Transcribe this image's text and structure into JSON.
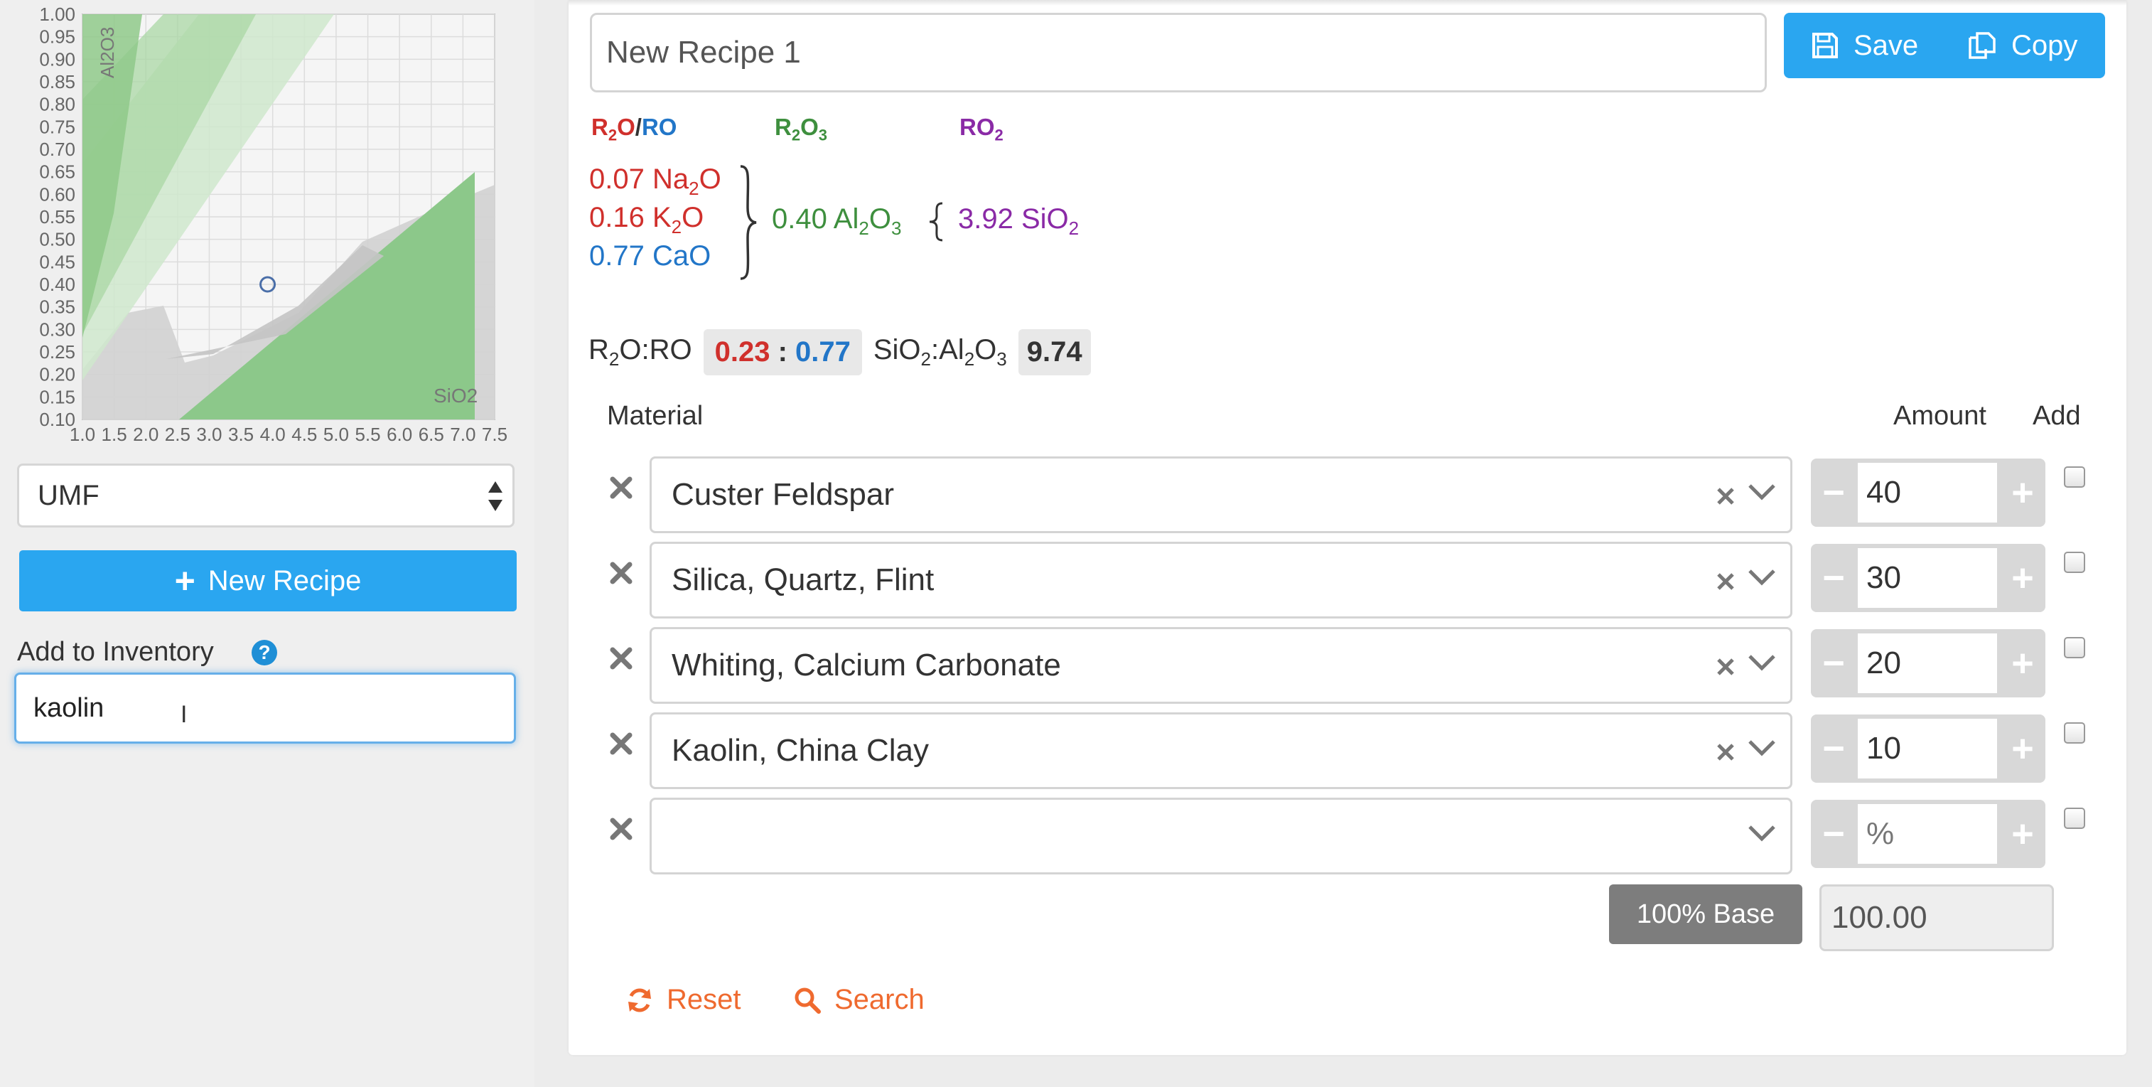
{
  "chart": {
    "y_axis_label": "Al2O3",
    "x_axis_label": "SiO2",
    "y_ticks": [
      "1.00",
      "0.95",
      "0.90",
      "0.85",
      "0.80",
      "0.75",
      "0.70",
      "0.65",
      "0.60",
      "0.55",
      "0.50",
      "0.45",
      "0.40",
      "0.35",
      "0.30",
      "0.25",
      "0.20",
      "0.15",
      "0.10"
    ],
    "x_ticks": [
      "1.0",
      "1.5",
      "2.0",
      "2.5",
      "3.0",
      "3.5",
      "4.0",
      "4.5",
      "5.0",
      "5.5",
      "6.0",
      "6.5",
      "7.0",
      "7.5"
    ],
    "point": {
      "sio2": 3.92,
      "al2o3": 0.4
    }
  },
  "sidebar": {
    "mode_select": "UMF",
    "new_recipe_label": "New Recipe",
    "inventory_label": "Add to Inventory",
    "inventory_value": "kaolin"
  },
  "recipe": {
    "name": "New Recipe 1",
    "save_label": "Save",
    "copy_label": "Copy",
    "reset_label": "Reset",
    "search_label": "Search"
  },
  "umf": {
    "headers": {
      "r2o": "R2O",
      "ro": "RO",
      "r2o3": "R2O3",
      "ro2": "RO2"
    },
    "fluxes": [
      {
        "amount": "0.07",
        "oxide": "Na2O",
        "color": "#d0302c"
      },
      {
        "amount": "0.16",
        "oxide": "K2O",
        "color": "#d0302c"
      },
      {
        "amount": "0.77",
        "oxide": "CaO",
        "color": "#2276c8"
      }
    ],
    "al2o3": {
      "amount": "0.40",
      "oxide": "Al2O3"
    },
    "sio2": {
      "amount": "3.92",
      "oxide": "SiO2"
    },
    "ratio_label": "R2O:RO",
    "ratio_r2o": "0.23",
    "ratio_ro": "0.77",
    "sio_al_label": "SiO2:Al2O3",
    "sio_al_value": "9.74"
  },
  "table": {
    "col_material": "Material",
    "col_amount": "Amount",
    "col_add": "Add",
    "rows": [
      {
        "material": "Custer Feldspar",
        "amount": "40"
      },
      {
        "material": "Silica, Quartz, Flint",
        "amount": "30"
      },
      {
        "material": "Whiting, Calcium Carbonate",
        "amount": "20"
      },
      {
        "material": "Kaolin, China Clay",
        "amount": "10"
      },
      {
        "material": "",
        "amount": "",
        "placeholder": "%"
      }
    ],
    "base_label": "100% Base",
    "base_total": "100.00"
  }
}
